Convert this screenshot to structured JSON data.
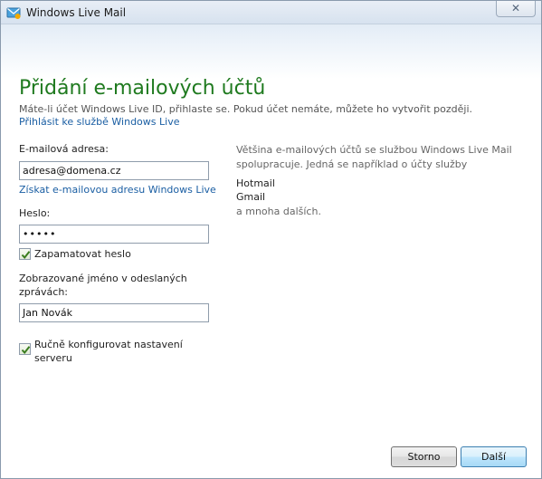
{
  "window": {
    "title": "Windows Live Mail",
    "close_glyph": "✕"
  },
  "page": {
    "heading": "Přidání e-mailových účtů",
    "subtext": "Máte-li účet Windows Live ID, přihlaste se. Pokud účet nemáte, můžete ho vytvořit později.",
    "signin_link": "Přihlásit ke službě Windows Live"
  },
  "form": {
    "email_label": "E-mailová adresa:",
    "email_value": "adresa@domena.cz",
    "get_email_link": "Získat e-mailovou adresu Windows Live",
    "password_label": "Heslo:",
    "password_value": "•••••",
    "remember_password_label": "Zapamatovat heslo",
    "remember_password_checked": true,
    "display_name_label_line1": "Zobrazované jméno v odeslaných",
    "display_name_label_line2": "zprávách:",
    "display_name_value": "Jan Novák",
    "manual_config_label_line1": "Ručně konfigurovat nastavení",
    "manual_config_label_line2": "serveru",
    "manual_config_checked": true
  },
  "info": {
    "line1": "Většina e-mailových účtů se službou Windows Live Mail",
    "line2": "spolupracuje. Jedná se například o účty služby",
    "providers": [
      "Hotmail",
      "Gmail"
    ],
    "more": "a mnoha dalších."
  },
  "buttons": {
    "cancel": "Storno",
    "next": "Další"
  },
  "colors": {
    "heading": "#1f7a1f",
    "link": "#1a5ea3"
  }
}
